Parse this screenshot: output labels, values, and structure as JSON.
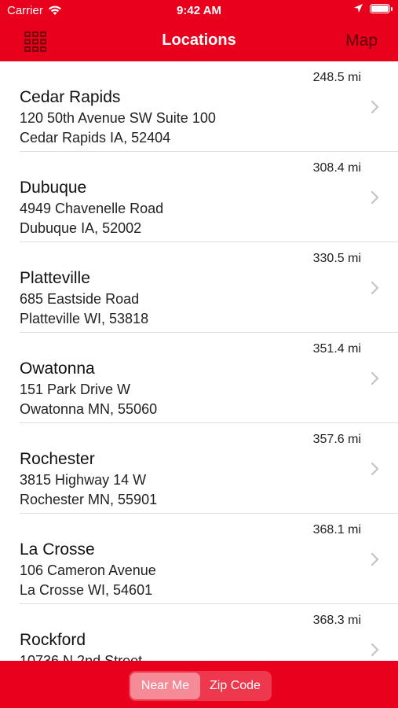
{
  "status_bar": {
    "carrier": "Carrier",
    "time": "9:42 AM"
  },
  "nav": {
    "title": "Locations",
    "map_label": "Map",
    "menu_icon": "grid-icon"
  },
  "locations": [
    {
      "distance": "248.5 mi",
      "name": "Cedar Rapids",
      "address_line1": "120 50th Avenue SW Suite 100",
      "address_line2": "Cedar Rapids IA, 52404"
    },
    {
      "distance": "308.4 mi",
      "name": "Dubuque",
      "address_line1": "4949 Chavenelle Road",
      "address_line2": "Dubuque IA, 52002"
    },
    {
      "distance": "330.5 mi",
      "name": "Platteville",
      "address_line1": "685 Eastside Road",
      "address_line2": "Platteville WI, 53818"
    },
    {
      "distance": "351.4 mi",
      "name": "Owatonna",
      "address_line1": "151 Park Drive W",
      "address_line2": "Owatonna MN, 55060"
    },
    {
      "distance": "357.6 mi",
      "name": "Rochester",
      "address_line1": "3815 Highway 14 W",
      "address_line2": "Rochester MN, 55901"
    },
    {
      "distance": "368.1 mi",
      "name": "La Crosse",
      "address_line1": "106 Cameron Avenue",
      "address_line2": "La Crosse WI, 54601"
    },
    {
      "distance": "368.3 mi",
      "name": "Rockford",
      "address_line1": "10736 N 2nd Street",
      "address_line2": ""
    }
  ],
  "tabs": {
    "near_me": "Near Me",
    "zip_code": "Zip Code",
    "selected": "near_me"
  },
  "colors": {
    "brand_red": "#e8001c",
    "map_text": "#5a0008"
  }
}
